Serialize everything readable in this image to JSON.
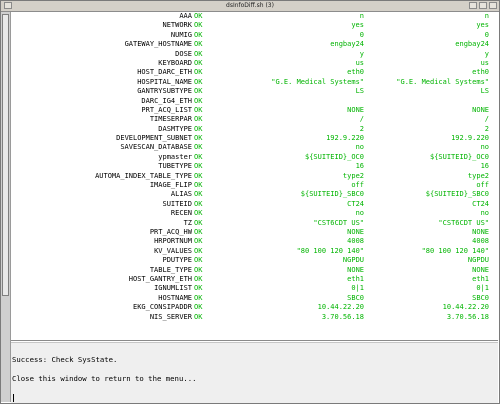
{
  "window": {
    "title": "dsInfoDiff.sh (3)"
  },
  "rows": [
    {
      "key": "AAA",
      "status": "OK",
      "value1": "n",
      "value2": "n"
    },
    {
      "key": "NETWORK",
      "status": "OK",
      "value1": "yes",
      "value2": "yes"
    },
    {
      "key": "NUMIG",
      "status": "OK",
      "value1": "0",
      "value2": "0"
    },
    {
      "key": "GATEWAY_HOSTNAME",
      "status": "OK",
      "value1": "engbay24",
      "value2": "engbay24"
    },
    {
      "key": "DOSE",
      "status": "OK",
      "value1": "y",
      "value2": "y"
    },
    {
      "key": "KEYBOARD",
      "status": "OK",
      "value1": "us",
      "value2": "us"
    },
    {
      "key": "HOST_DARC_ETH",
      "status": "OK",
      "value1": "eth0",
      "value2": "eth0"
    },
    {
      "key": "HOSPITAL_NAME",
      "status": "OK",
      "value1": "\"G.E. Medical Systems\"",
      "value2": "\"G.E. Medical Systems\""
    },
    {
      "key": "GANTRYSUBTYPE",
      "status": "OK",
      "value1": "LS",
      "value2": "LS"
    },
    {
      "key": "DARC_IG4_ETH",
      "status": "OK",
      "value1": "",
      "value2": ""
    },
    {
      "key": "PRT_ACQ_LIST",
      "status": "OK",
      "value1": "NONE",
      "value2": "NONE"
    },
    {
      "key": "TIMESERPAR",
      "status": "OK",
      "value1": "/",
      "value2": "/"
    },
    {
      "key": "DASMTYPE",
      "status": "OK",
      "value1": "2",
      "value2": "2"
    },
    {
      "key": "DEVELOPMENT_SUBNET",
      "status": "OK",
      "value1": "192.9.220",
      "value2": "192.9.220"
    },
    {
      "key": "SAVESCAN_DATABASE",
      "status": "OK",
      "value1": "no",
      "value2": "no"
    },
    {
      "key": "ypmaster",
      "status": "OK",
      "value1": "${SUITEID}_OC0",
      "value2": "${SUITEID}_OC0"
    },
    {
      "key": "TUBETYPE",
      "status": "OK",
      "value1": "16",
      "value2": "16"
    },
    {
      "key": "AUTOMA_INDEX_TABLE_TYPE",
      "status": "OK",
      "value1": "type2",
      "value2": "type2"
    },
    {
      "key": "IMAGE_FLIP",
      "status": "OK",
      "value1": "off",
      "value2": "off"
    },
    {
      "key": "ALIAS",
      "status": "OK",
      "value1": "${SUITEID}_SBC0",
      "value2": "${SUITEID}_SBC0"
    },
    {
      "key": "SUITEID",
      "status": "OK",
      "value1": "CT24",
      "value2": "CT24"
    },
    {
      "key": "RECEN",
      "status": "OK",
      "value1": "no",
      "value2": "no"
    },
    {
      "key": "TZ",
      "status": "OK",
      "value1": "\"CST6CDT US\"",
      "value2": "\"CST6CDT US\""
    },
    {
      "key": "PRT_ACQ_HW",
      "status": "OK",
      "value1": "NONE",
      "value2": "NONE"
    },
    {
      "key": "HRPORTNUM",
      "status": "OK",
      "value1": "4008",
      "value2": "4008"
    },
    {
      "key": "KV_VALUES",
      "status": "OK",
      "value1": "\"80 100 120 140\"",
      "value2": "\"80 100 120 140\""
    },
    {
      "key": "PDUTYPE",
      "status": "OK",
      "value1": "NGPDU",
      "value2": "NGPDU"
    },
    {
      "key": "TABLE_TYPE",
      "status": "OK",
      "value1": "NONE",
      "value2": "NONE"
    },
    {
      "key": "HOST_GANTRY_ETH",
      "status": "OK",
      "value1": "eth1",
      "value2": "eth1"
    },
    {
      "key": "IGNUMLIST",
      "status": "OK",
      "value1": "0|1",
      "value2": "0|1"
    },
    {
      "key": "HOSTNAME",
      "status": "OK",
      "value1": "SBC0",
      "value2": "SBC0"
    },
    {
      "key": "EKG_CONSIPADDR",
      "status": "OK",
      "value1": "10.44.22.20",
      "value2": "10.44.22.20"
    },
    {
      "key": "NIS_SERVER",
      "status": "OK",
      "value1": "3.70.56.18",
      "value2": "3.70.56.18"
    }
  ],
  "status_pane": {
    "message1": "Success: Check SysState.",
    "message2": "Close this window to return to the menu..."
  }
}
